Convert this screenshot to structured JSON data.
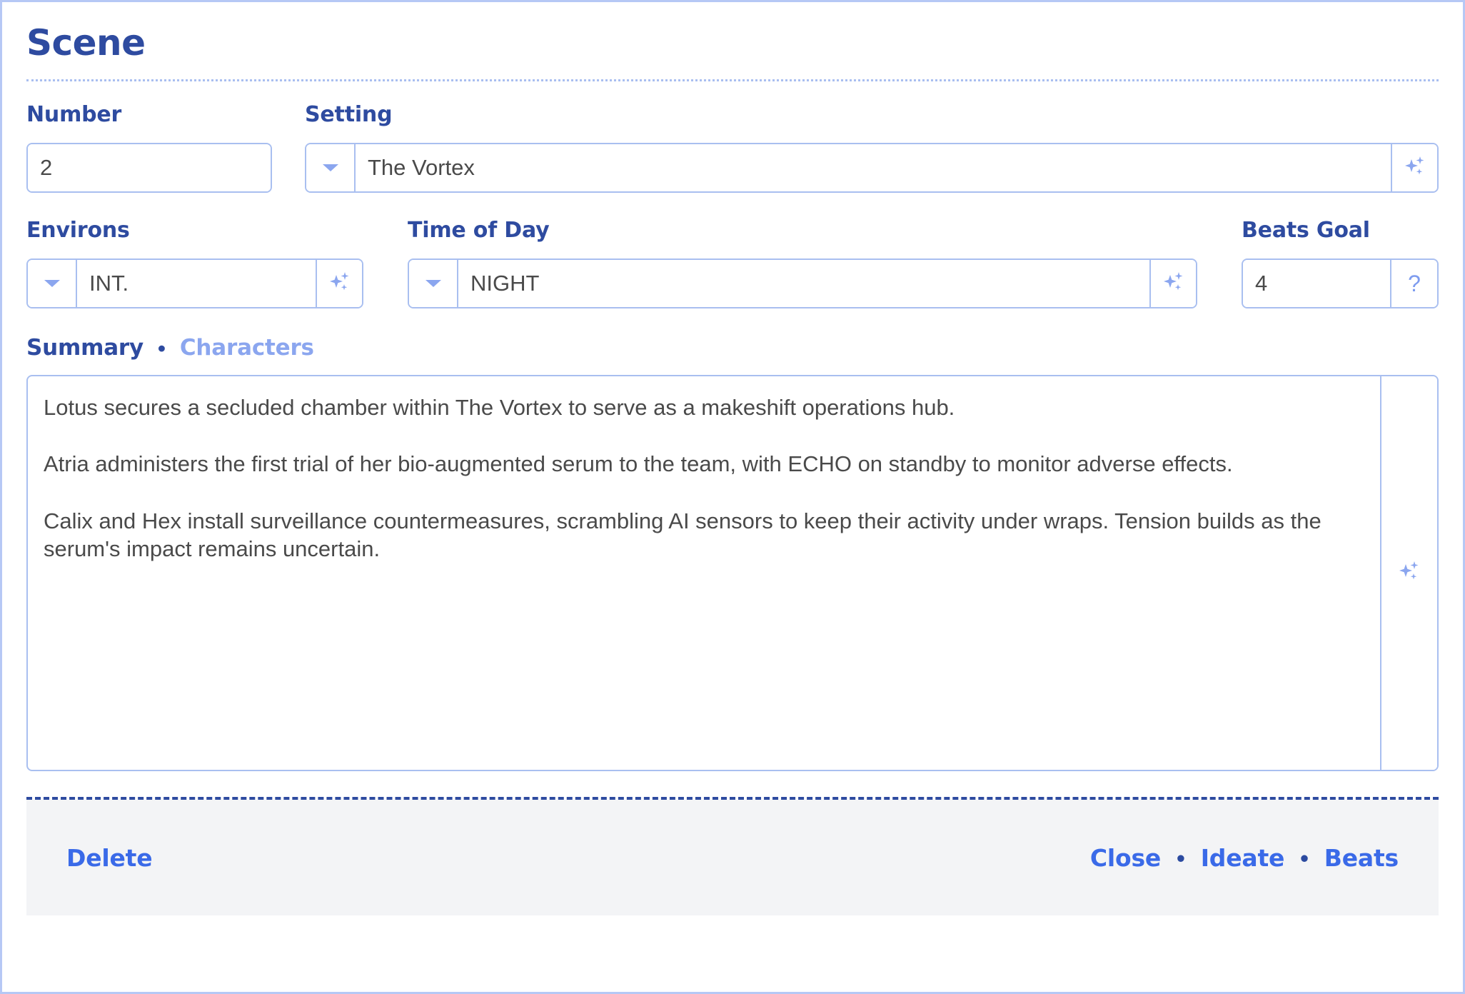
{
  "panel": {
    "title": "Scene"
  },
  "fields": {
    "number": {
      "label": "Number",
      "value": "2"
    },
    "setting": {
      "label": "Setting",
      "value": "The Vortex",
      "caret_icon": "chevron-down-icon",
      "ai_icon": "sparkles-icon"
    },
    "environs": {
      "label": "Environs",
      "value": "INT.",
      "caret_icon": "chevron-down-icon",
      "ai_icon": "sparkles-icon"
    },
    "time_of_day": {
      "label": "Time of Day",
      "value": "NIGHT",
      "caret_icon": "chevron-down-icon",
      "ai_icon": "sparkles-icon"
    },
    "beats_goal": {
      "label": "Beats Goal",
      "value": "4",
      "help_label": "?"
    }
  },
  "tabs": {
    "separator": "•",
    "items": [
      {
        "label": "Summary",
        "active": true
      },
      {
        "label": "Characters",
        "active": false
      }
    ]
  },
  "summary": {
    "text": "Lotus secures a secluded chamber within The Vortex to serve as a makeshift operations hub.\n\nAtria administers the first trial of her bio-augmented serum to the team, with ECHO on standby to monitor adverse effects.\n\nCalix and Hex install surveillance countermeasures, scrambling AI sensors to keep their activity under wraps. Tension builds as the serum's impact remains uncertain.",
    "ai_icon": "sparkles-icon"
  },
  "footer": {
    "delete_label": "Delete",
    "separator": "•",
    "close_label": "Close",
    "ideate_label": "Ideate",
    "beats_label": "Beats"
  },
  "colors": {
    "heading_blue": "#2e4ba0",
    "light_blue_border": "#a9bff0",
    "accent_blue": "#3a6ae8",
    "muted_blue": "#8ba6ef",
    "text_gray": "#4a4a4a",
    "footer_bg": "#f3f4f6"
  }
}
